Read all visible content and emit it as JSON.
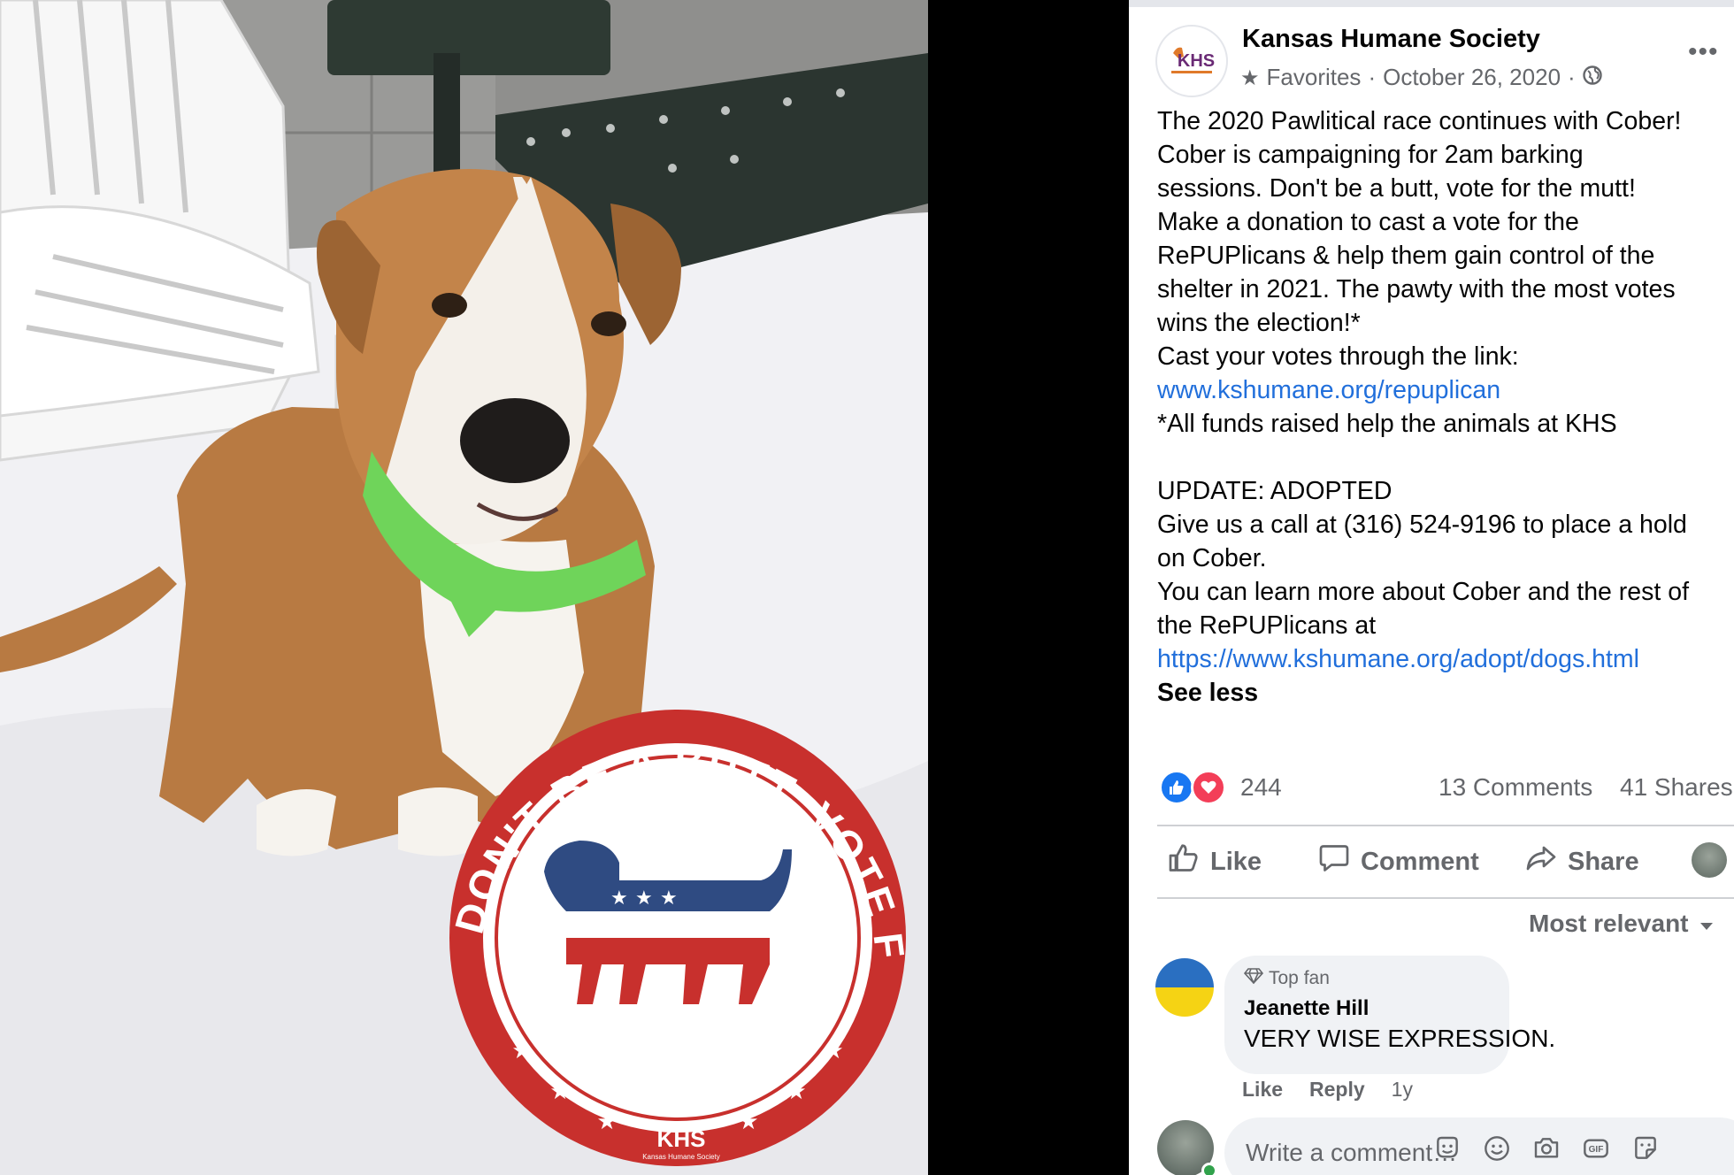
{
  "photo": {
    "badge_text": "DON'T BE A BUTT, VOTE FOR THE MUTT",
    "badge_logo": "KHS",
    "badge_logo_sub": "Kansas Humane Society",
    "colors": {
      "badge_red": "#c8302d",
      "badge_blue": "#2f4b82",
      "dog_fur": "#b87a42"
    }
  },
  "post": {
    "page_logo_text": "KHS",
    "page_name": "Kansas Humane Society",
    "favorites_label": "Favorites",
    "separator": "·",
    "date": "October 26, 2020",
    "more_label": "•••",
    "body_lines": [
      "The 2020 Pawlitical race continues with Cober!",
      "Cober is campaigning for 2am barking",
      "sessions. Don't be a butt, vote for the mutt!",
      "Make a donation to cast a vote for the",
      "RePUPlicans & help them gain control of the",
      "shelter in 2021. The pawty with the most votes",
      "wins the election!*",
      "Cast your votes through the link:"
    ],
    "link_1": "www.kshumane.org/repuplican",
    "note": "*All funds raised help the animals at KHS",
    "update_lines": [
      "UPDATE: ADOPTED",
      "Give us a call at (316) 524-9196 to place a hold",
      "on Cober.",
      "You can learn more about Cober and the rest of",
      "the RePUPlicans at"
    ],
    "link_2": "https://www.kshumane.org/adopt/dogs.html",
    "see_less": "See less",
    "reaction_count": "244",
    "comments_count": "13 Comments",
    "shares_count": "41 Shares",
    "actions": {
      "like": "Like",
      "comment": "Comment",
      "share": "Share"
    },
    "sort_label": "Most relevant",
    "colors": {
      "link": "#216fdb",
      "like_blue": "#1877f2",
      "love_red": "#f33e58",
      "muted": "#65676b"
    }
  },
  "comment": {
    "badge": "Top fan",
    "author": "Jeanette Hill",
    "text": "VERY WISE EXPRESSION.",
    "like_label": "Like",
    "reply_label": "Reply",
    "time": "1y"
  },
  "composer": {
    "placeholder": "Write a comment…",
    "icons": [
      "sticker-icon",
      "emoji-icon",
      "camera-icon",
      "gif-icon",
      "sticker-alt-icon"
    ]
  }
}
